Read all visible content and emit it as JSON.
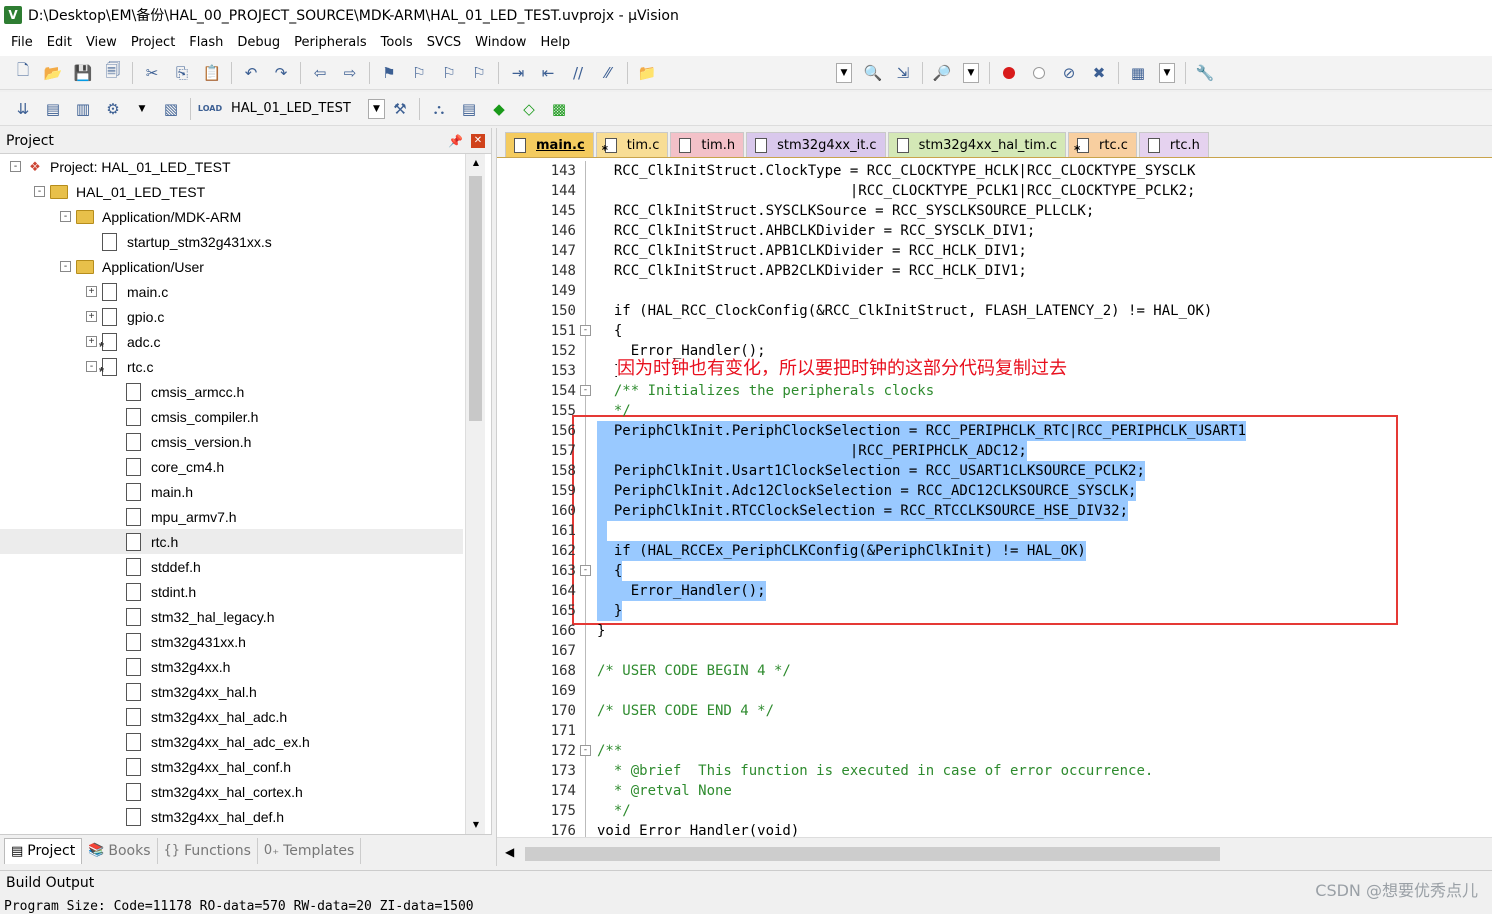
{
  "window": {
    "title": "D:\\Desktop\\EM\\备份\\HAL_00_PROJECT_SOURCE\\MDK-ARM\\HAL_01_LED_TEST.uvprojx - µVision",
    "app_icon": "V"
  },
  "menu": [
    "File",
    "Edit",
    "View",
    "Project",
    "Flash",
    "Debug",
    "Peripherals",
    "Tools",
    "SVCS",
    "Window",
    "Help"
  ],
  "toolbar2": {
    "target_label": "LOAD",
    "target_name": "HAL_01_LED_TEST"
  },
  "project_panel": {
    "title": "Project",
    "tree": [
      {
        "label": "Project: HAL_01_LED_TEST",
        "level": 0,
        "icon": "project-icon",
        "expander": "-"
      },
      {
        "label": "HAL_01_LED_TEST",
        "level": 1,
        "icon": "target-folder-icon",
        "expander": "-"
      },
      {
        "label": "Application/MDK-ARM",
        "level": 2,
        "icon": "folder-icon",
        "expander": "-"
      },
      {
        "label": "startup_stm32g431xx.s",
        "level": 3,
        "icon": "file-icon",
        "expander": ""
      },
      {
        "label": "Application/User",
        "level": 2,
        "icon": "folder-icon",
        "expander": "-"
      },
      {
        "label": "main.c",
        "level": 3,
        "icon": "file-icon",
        "expander": "+"
      },
      {
        "label": "gpio.c",
        "level": 3,
        "icon": "file-icon",
        "expander": "+"
      },
      {
        "label": "adc.c",
        "level": 3,
        "icon": "gear-file-icon",
        "expander": "+"
      },
      {
        "label": "rtc.c",
        "level": 3,
        "icon": "gear-file-icon",
        "expander": "-"
      },
      {
        "label": "cmsis_armcc.h",
        "level": 4,
        "icon": "file-icon",
        "expander": ""
      },
      {
        "label": "cmsis_compiler.h",
        "level": 4,
        "icon": "file-icon",
        "expander": ""
      },
      {
        "label": "cmsis_version.h",
        "level": 4,
        "icon": "file-icon",
        "expander": ""
      },
      {
        "label": "core_cm4.h",
        "level": 4,
        "icon": "file-icon",
        "expander": ""
      },
      {
        "label": "main.h",
        "level": 4,
        "icon": "file-icon",
        "expander": ""
      },
      {
        "label": "mpu_armv7.h",
        "level": 4,
        "icon": "file-icon",
        "expander": ""
      },
      {
        "label": "rtc.h",
        "level": 4,
        "icon": "file-icon",
        "expander": "",
        "selected": true
      },
      {
        "label": "stddef.h",
        "level": 4,
        "icon": "file-icon",
        "expander": ""
      },
      {
        "label": "stdint.h",
        "level": 4,
        "icon": "file-icon",
        "expander": ""
      },
      {
        "label": "stm32_hal_legacy.h",
        "level": 4,
        "icon": "file-icon",
        "expander": ""
      },
      {
        "label": "stm32g431xx.h",
        "level": 4,
        "icon": "file-icon",
        "expander": ""
      },
      {
        "label": "stm32g4xx.h",
        "level": 4,
        "icon": "file-icon",
        "expander": ""
      },
      {
        "label": "stm32g4xx_hal.h",
        "level": 4,
        "icon": "file-icon",
        "expander": ""
      },
      {
        "label": "stm32g4xx_hal_adc.h",
        "level": 4,
        "icon": "file-icon",
        "expander": ""
      },
      {
        "label": "stm32g4xx_hal_adc_ex.h",
        "level": 4,
        "icon": "file-icon",
        "expander": ""
      },
      {
        "label": "stm32g4xx_hal_conf.h",
        "level": 4,
        "icon": "file-icon",
        "expander": ""
      },
      {
        "label": "stm32g4xx_hal_cortex.h",
        "level": 4,
        "icon": "file-icon",
        "expander": ""
      },
      {
        "label": "stm32g4xx_hal_def.h",
        "level": 4,
        "icon": "file-icon",
        "expander": ""
      }
    ],
    "tabs": [
      {
        "label": "Project",
        "icon": "project-tab-icon",
        "active": true
      },
      {
        "label": "Books",
        "icon": "books-icon",
        "active": false
      },
      {
        "label": "Functions",
        "icon": "functions-icon",
        "active": false
      },
      {
        "label": "Templates",
        "icon": "templates-icon",
        "active": false
      }
    ]
  },
  "editor": {
    "tabs": [
      {
        "label": "main.c",
        "style": "active",
        "gear": false
      },
      {
        "label": "tim.c",
        "style": "c-yellow",
        "gear": true
      },
      {
        "label": "tim.h",
        "style": "c-pink",
        "gear": false
      },
      {
        "label": "stm32g4xx_it.c",
        "style": "c-purple",
        "gear": false
      },
      {
        "label": "stm32g4xx_hal_tim.c",
        "style": "c-green",
        "gear": false
      },
      {
        "label": "rtc.c",
        "style": "c-orange",
        "gear": true
      },
      {
        "label": "rtc.h",
        "style": "c-lav",
        "gear": false
      }
    ],
    "lines": [
      {
        "n": "143",
        "text": "  RCC_ClkInitStruct.ClockType = RCC_CLOCKTYPE_HCLK|RCC_CLOCKTYPE_SYSCLK"
      },
      {
        "n": "144",
        "text": "                              |RCC_CLOCKTYPE_PCLK1|RCC_CLOCKTYPE_PCLK2;"
      },
      {
        "n": "145",
        "text": "  RCC_ClkInitStruct.SYSCLKSource = RCC_SYSCLKSOURCE_PLLCLK;"
      },
      {
        "n": "146",
        "text": "  RCC_ClkInitStruct.AHBCLKDivider = RCC_SYSCLK_DIV1;"
      },
      {
        "n": "147",
        "text": "  RCC_ClkInitStruct.APB1CLKDivider = RCC_HCLK_DIV1;"
      },
      {
        "n": "148",
        "text": "  RCC_ClkInitStruct.APB2CLKDivider = RCC_HCLK_DIV1;"
      },
      {
        "n": "149",
        "text": ""
      },
      {
        "n": "150",
        "text": "  if (HAL_RCC_ClockConfig(&RCC_ClkInitStruct, FLASH_LATENCY_2) != HAL_OK)"
      },
      {
        "n": "151",
        "text": "  {",
        "fold": "-"
      },
      {
        "n": "152",
        "text": "    Error_Handler();"
      },
      {
        "n": "153",
        "text": "  }"
      },
      {
        "n": "154",
        "text": "  /** Initializes the peripherals clocks",
        "fold": "-",
        "kind": "comment"
      },
      {
        "n": "155",
        "text": "  */",
        "kind": "comment"
      },
      {
        "n": "156",
        "text": "  PeriphClkInit.PeriphClockSelection = RCC_PERIPHCLK_RTC|RCC_PERIPHCLK_USART1",
        "kind": "hl"
      },
      {
        "n": "157",
        "text": "                              |RCC_PERIPHCLK_ADC12;",
        "kind": "hl"
      },
      {
        "n": "158",
        "text": "  PeriphClkInit.Usart1ClockSelection = RCC_USART1CLKSOURCE_PCLK2;",
        "kind": "hl"
      },
      {
        "n": "159",
        "text": "  PeriphClkInit.Adc12ClockSelection = RCC_ADC12CLKSOURCE_SYSCLK;",
        "kind": "hl"
      },
      {
        "n": "160",
        "text": "  PeriphClkInit.RTCClockSelection = RCC_RTCCLKSOURCE_HSE_DIV32;",
        "kind": "hl"
      },
      {
        "n": "161",
        "text": " ",
        "kind": "hl"
      },
      {
        "n": "162",
        "text": "  if (HAL_RCCEx_PeriphCLKConfig(&PeriphClkInit) != HAL_OK)",
        "kind": "hl"
      },
      {
        "n": "163",
        "text": "  {",
        "fold": "-",
        "kind": "hl"
      },
      {
        "n": "164",
        "text": "    Error_Handler();",
        "kind": "hl"
      },
      {
        "n": "165",
        "text": "  }",
        "kind": "hl"
      },
      {
        "n": "166",
        "text": "}"
      },
      {
        "n": "167",
        "text": ""
      },
      {
        "n": "168",
        "text": "/* USER CODE BEGIN 4 */",
        "kind": "comment"
      },
      {
        "n": "169",
        "text": ""
      },
      {
        "n": "170",
        "text": "/* USER CODE END 4 */",
        "kind": "comment"
      },
      {
        "n": "171",
        "text": ""
      },
      {
        "n": "172",
        "text": "/**",
        "fold": "-",
        "kind": "comment"
      },
      {
        "n": "173",
        "text": "  * @brief  This function is executed in case of error occurrence.",
        "kind": "comment"
      },
      {
        "n": "174",
        "text": "  * @retval None",
        "kind": "comment"
      },
      {
        "n": "175",
        "text": "  */",
        "kind": "comment"
      },
      {
        "n": "176",
        "text": "void Error_Handler(void)"
      }
    ],
    "annotation_note": "因为时钟也有变化，所以要把时钟的这部分代码复制过去"
  },
  "build_output": {
    "title": "Build Output",
    "text": "Program Size: Code=11178 RO-data=570 RW-data=20 ZI-data=1500"
  },
  "watermark": "CSDN @想要优秀点儿",
  "colors": {
    "selection": "#99c9ff",
    "annotation": "#e53935",
    "active_tab": "#f4cb5f",
    "comment": "#2e8b2e"
  }
}
